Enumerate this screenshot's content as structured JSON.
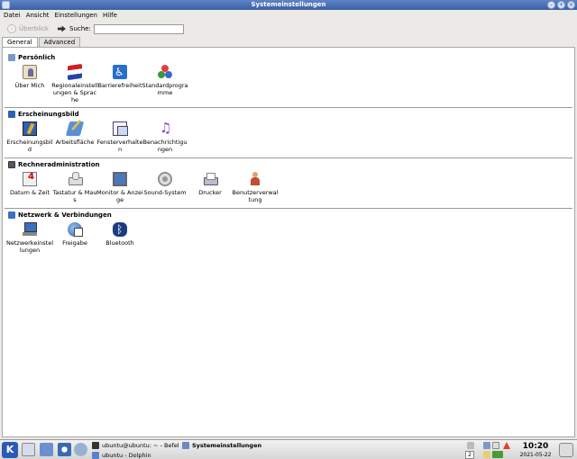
{
  "window": {
    "title": "Systemeinstellungen"
  },
  "menubar": [
    "Datei",
    "Ansicht",
    "Einstellungen",
    "Hilfe"
  ],
  "toolbar": {
    "back_label": "Überblick",
    "search_label": "Suche:",
    "search_value": ""
  },
  "tabs": [
    {
      "label": "General",
      "active": true
    },
    {
      "label": "Advanced",
      "active": false
    }
  ],
  "sections": [
    {
      "title": "Persönlich",
      "icon": "user-icon",
      "items": [
        {
          "label": "Über Mich",
          "icon": "about-me-icon"
        },
        {
          "label": "Regionaleinstellungen & Sprache",
          "icon": "flags-icon"
        },
        {
          "label": "Barrierefreiheit",
          "icon": "accessibility-icon"
        },
        {
          "label": "Standardprogramme",
          "icon": "default-apps-icon"
        }
      ]
    },
    {
      "title": "Erscheinungsbild",
      "icon": "appearance-icon",
      "items": [
        {
          "label": "Erscheinungsbild",
          "icon": "appearance-icon"
        },
        {
          "label": "Arbeitsfläche",
          "icon": "desktop-icon"
        },
        {
          "label": "Fensterverhalten",
          "icon": "window-icon"
        },
        {
          "label": "Benachrichtigungen",
          "icon": "music-note-icon"
        }
      ]
    },
    {
      "title": "Rechneradministration",
      "icon": "computer-icon",
      "items": [
        {
          "label": "Datum & Zeit",
          "icon": "calendar-clock-icon"
        },
        {
          "label": "Tastatur & Maus",
          "icon": "keyboard-mouse-icon"
        },
        {
          "label": "Monitor & Anzeige",
          "icon": "monitor-icon"
        },
        {
          "label": "Sound-System",
          "icon": "speaker-icon"
        },
        {
          "label": "Drucker",
          "icon": "printer-icon"
        },
        {
          "label": "Benutzerverwaltung",
          "icon": "user-manager-icon"
        }
      ]
    },
    {
      "title": "Netzwerk & Verbindungen",
      "icon": "network-icon",
      "items": [
        {
          "label": "Netzwerkeinstellungen",
          "icon": "network-icon"
        },
        {
          "label": "Freigabe",
          "icon": "sharing-icon"
        },
        {
          "label": "Bluetooth",
          "icon": "bluetooth-icon"
        }
      ]
    }
  ],
  "taskbar": {
    "k_menu_label": "K",
    "tasks": [
      {
        "label": "ubuntu@ubuntu: ~ - Befehl",
        "active": false
      },
      {
        "label": "Systemeinstellungen",
        "active": true
      },
      {
        "label": "ubuntu - Dolphin",
        "active": false
      }
    ],
    "pager": "2",
    "clock_time": "10:20",
    "clock_date": "2021-05-22"
  }
}
